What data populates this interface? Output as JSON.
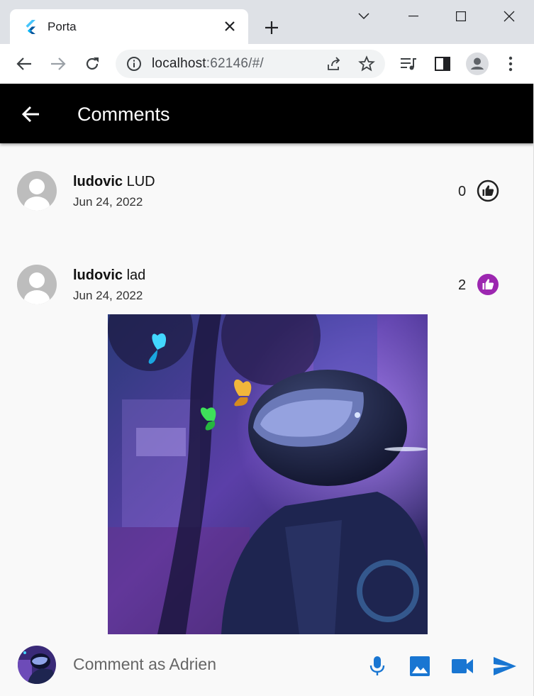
{
  "browser": {
    "tab_title": "Porta",
    "url_host": "localhost",
    "url_rest": ":62146/#/",
    "icons": {
      "favicon": "flutter-icon",
      "tab_close": "close-icon",
      "new_tab": "plus-icon",
      "minimize": "minimize-icon",
      "maximize": "maximize-icon",
      "close_window": "close-icon",
      "tab_search": "chevron-down-icon",
      "back": "arrow-left-icon",
      "forward": "arrow-right-icon",
      "reload": "reload-icon",
      "site_info": "info-icon",
      "share": "share-icon",
      "bookmark": "star-icon",
      "media": "playlist-icon",
      "side_panel": "side-panel-icon",
      "profile": "profile-icon",
      "menu": "kebab-menu-icon"
    }
  },
  "appbar": {
    "title": "Comments",
    "back_icon": "arrow-back-icon"
  },
  "comments": [
    {
      "username": "ludovic",
      "text": "LUD",
      "date": "Jun 24, 2022",
      "likes": "0",
      "liked": false,
      "has_image": false
    },
    {
      "username": "ludovic",
      "text": "lad",
      "date": "Jun 24, 2022",
      "likes": "2",
      "liked": true,
      "has_image": true
    }
  ],
  "composer": {
    "placeholder": "Comment as Adrien",
    "icons": [
      "mic-icon",
      "image-icon",
      "videocam-icon",
      "send-icon"
    ]
  },
  "colors": {
    "appbar": "#000000",
    "accent_blue": "#1976d2",
    "liked_purple": "#9c27b0",
    "background": "#f9f9f9"
  }
}
